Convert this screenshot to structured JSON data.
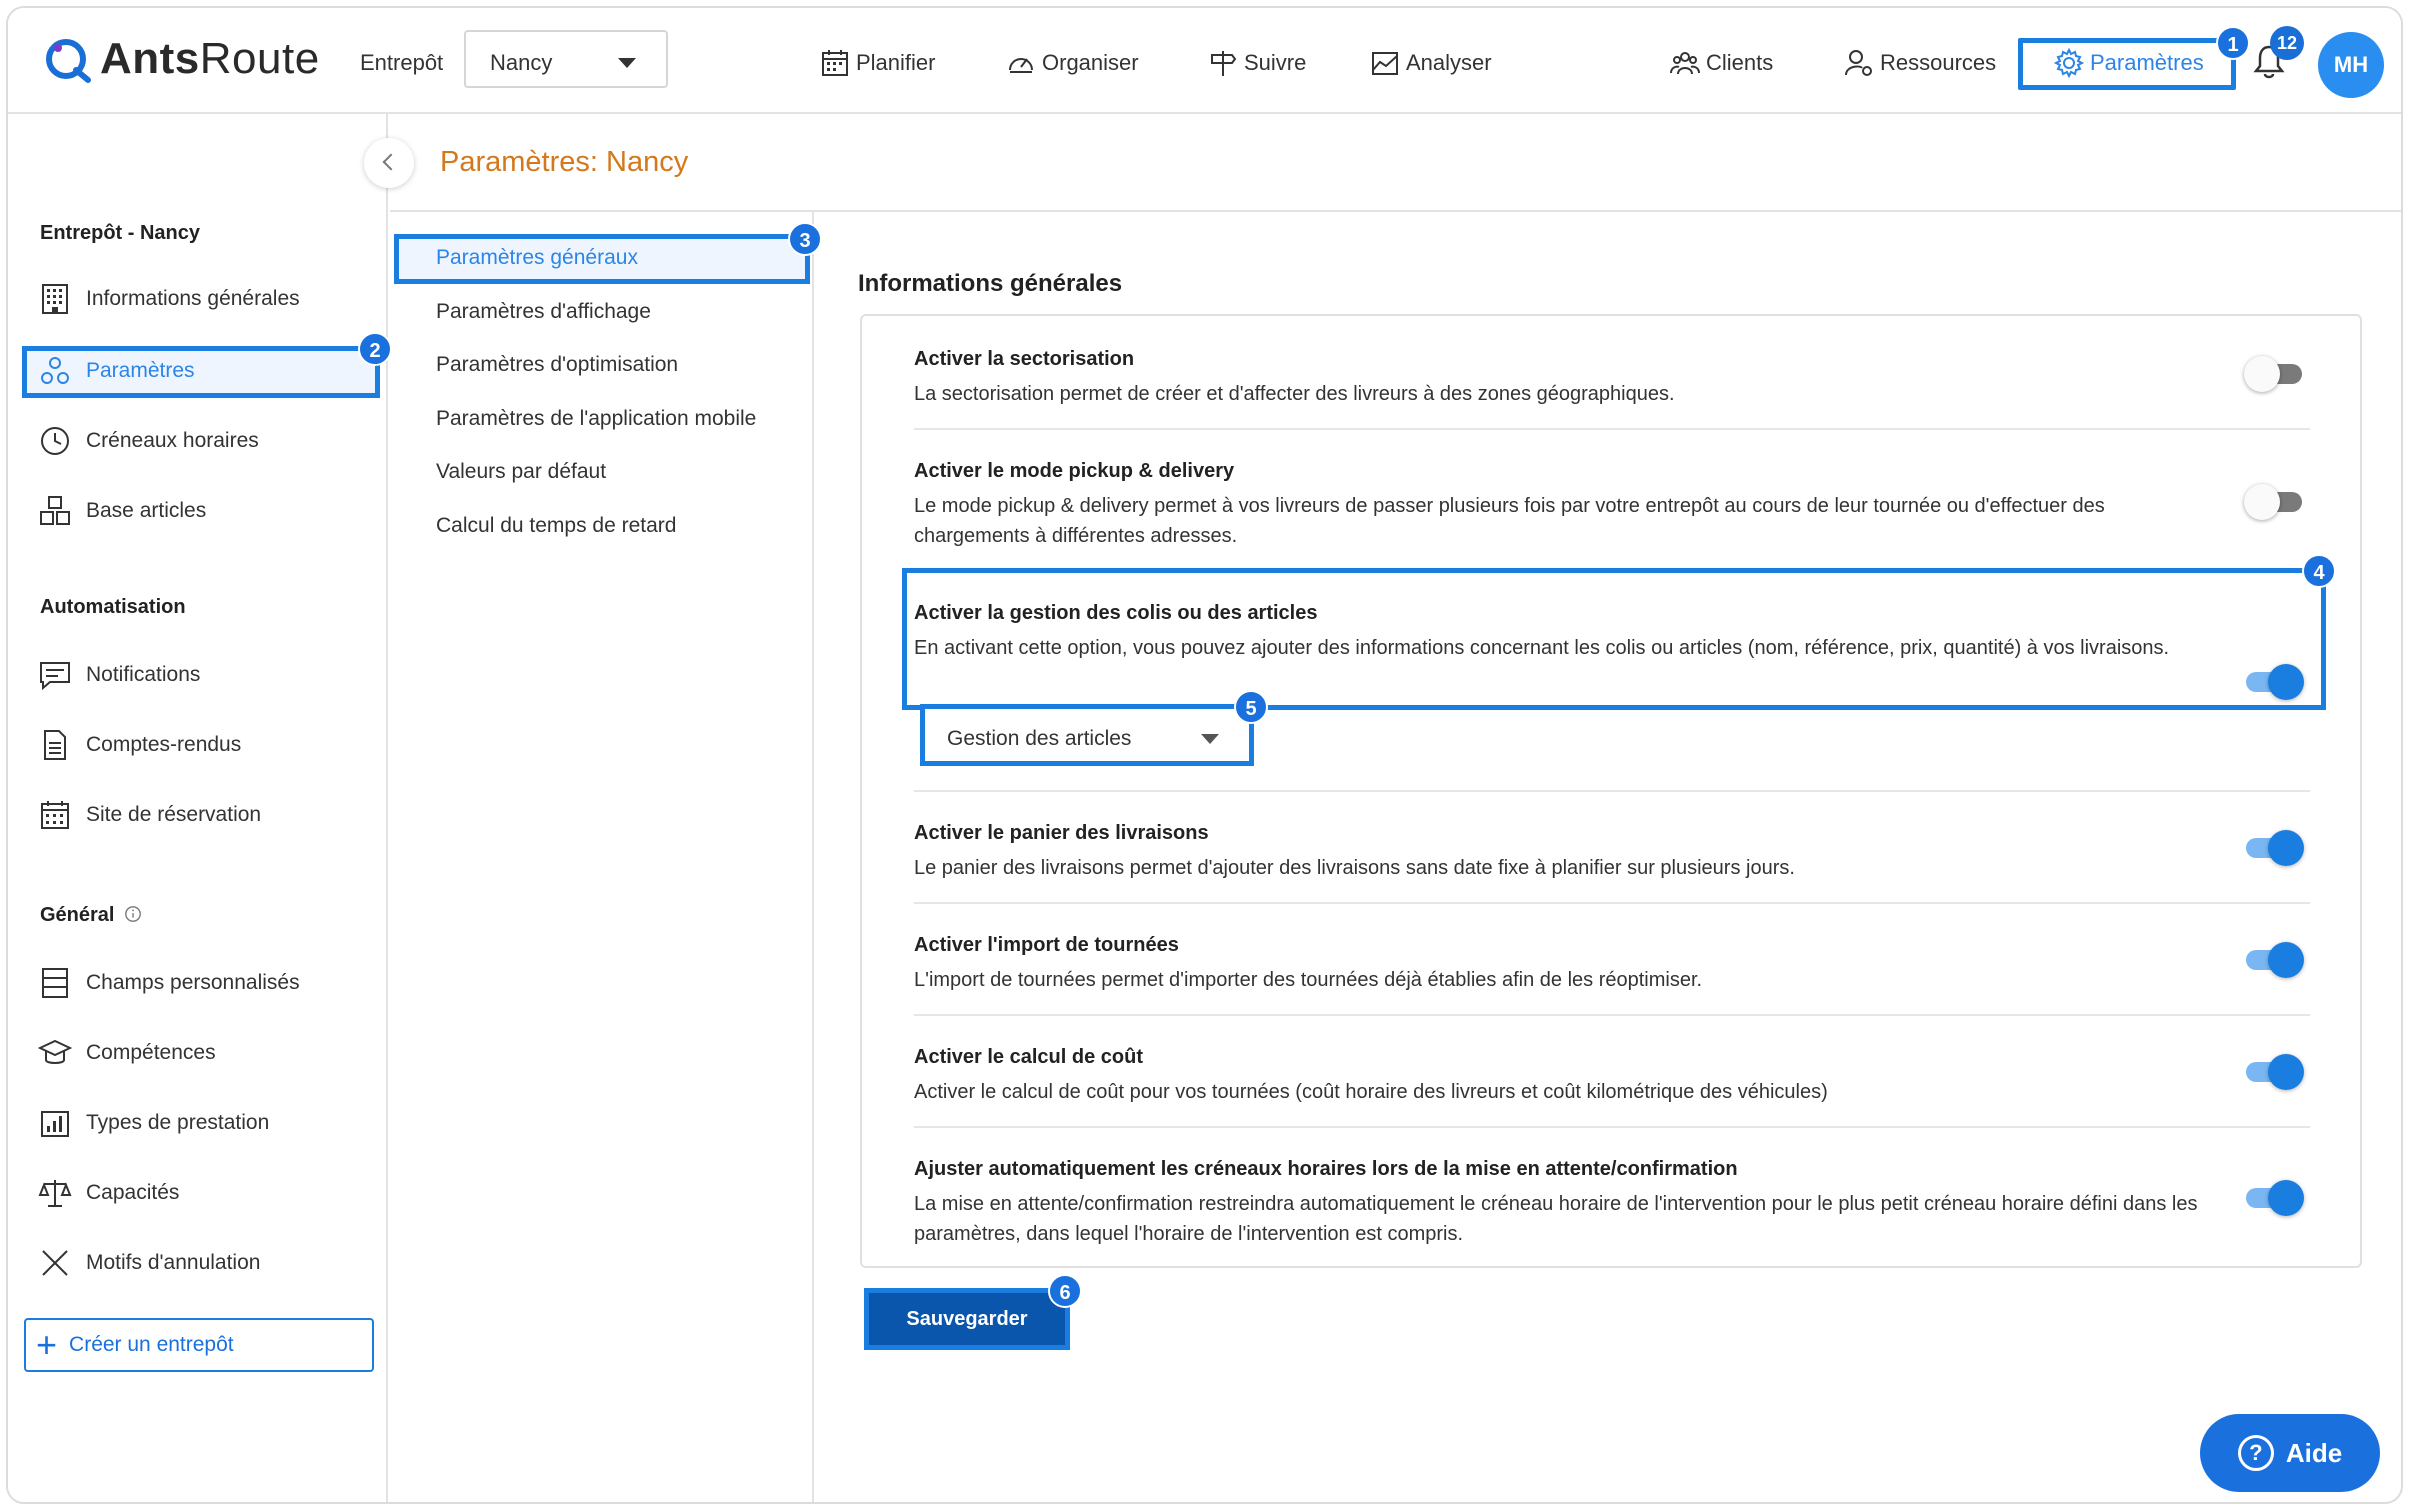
{
  "header": {
    "logo_bold": "Ants",
    "logo_light": "Route",
    "entrepot_label": "Entrepôt",
    "entrepot_value": "Nancy",
    "nav": [
      "Planifier",
      "Organiser",
      "Suivre",
      "Analyser"
    ],
    "right_nav": [
      "Clients",
      "Ressources",
      "Paramètres"
    ],
    "notifications_count": "12",
    "avatar_initials": "MH"
  },
  "steps": [
    "1",
    "2",
    "3",
    "4",
    "5",
    "6"
  ],
  "sidebar": {
    "section1": "Entrepôt - Nancy",
    "items1": [
      "Informations générales",
      "Paramètres",
      "Créneaux horaires",
      "Base articles"
    ],
    "section2": "Automatisation",
    "items2": [
      "Notifications",
      "Comptes-rendus",
      "Site de réservation"
    ],
    "section3": "Général",
    "items3": [
      "Champs personnalisés",
      "Compétences",
      "Types de prestation",
      "Capacités",
      "Motifs d'annulation"
    ],
    "create_label": "Créer un entrepôt"
  },
  "page": {
    "title": "Paramètres: Nancy",
    "submenu": [
      "Paramètres généraux",
      "Paramètres d'affichage",
      "Paramètres d'optimisation",
      "Paramètres de l'application mobile",
      "Valeurs par défaut",
      "Calcul du temps de retard"
    ],
    "section_heading": "Informations générales"
  },
  "settings": [
    {
      "title": "Activer la sectorisation",
      "desc": "La sectorisation permet de créer et d'affecter des livreurs à des zones géographiques.",
      "enabled": false
    },
    {
      "title": "Activer le mode pickup & delivery",
      "desc": "Le mode pickup & delivery permet à vos livreurs de passer plusieurs fois par votre entrepôt au cours de leur tournée ou d'effectuer des chargements à différentes adresses.",
      "enabled": false
    },
    {
      "title": "Activer la gestion des colis ou des articles",
      "desc": "En activant cette option, vous pouvez ajouter des informations concernant les colis ou articles (nom, référence, prix, quantité) à vos livraisons.",
      "enabled": true
    },
    {
      "title": "Activer le panier des livraisons",
      "desc": "Le panier des livraisons permet d'ajouter des livraisons sans date fixe à planifier sur plusieurs jours.",
      "enabled": true
    },
    {
      "title": "Activer l'import de tournées",
      "desc": "L'import de tournées permet d'importer des tournées déjà établies afin de les réoptimiser.",
      "enabled": true
    },
    {
      "title": "Activer le calcul de coût",
      "desc": "Activer le calcul de coût pour vos tournées (coût horaire des livreurs et coût kilométrique des véhicules)",
      "enabled": true
    },
    {
      "title": "Ajuster automatiquement les créneaux horaires lors de la mise en attente/confirmation",
      "desc": "La mise en attente/confirmation restreindra automatiquement le créneau horaire de l'intervention pour le plus petit créneau horaire défini dans les paramètres, dans lequel l'horaire de l'intervention est compris.",
      "enabled": true
    }
  ],
  "articles_mode": "Gestion des articles",
  "save_label": "Sauvegarder",
  "help_label": "Aide",
  "colors": {
    "accent": "#1a7de0",
    "title_orange": "#d4781c",
    "save_bg": "#0a56ad"
  }
}
